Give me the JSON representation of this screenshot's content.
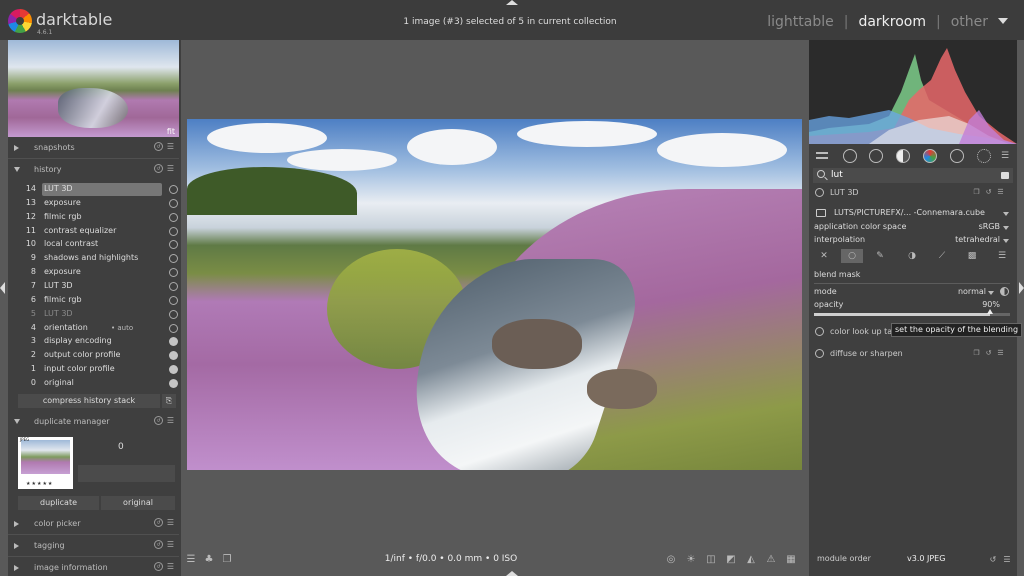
{
  "topbar": {
    "app_name": "darktable",
    "version": "4.6.1",
    "status": "1 image (#3) selected of 5 in current collection",
    "views": {
      "lighttable": "lighttable",
      "darkroom": "darkroom",
      "other": "other"
    }
  },
  "left_panel": {
    "navigation": {
      "zoom_label": "fit"
    },
    "snapshots": {
      "label": "snapshots"
    },
    "history": {
      "label": "history",
      "items": [
        {
          "num": "14",
          "name": "LUT 3D"
        },
        {
          "num": "13",
          "name": "exposure"
        },
        {
          "num": "12",
          "name": "filmic rgb"
        },
        {
          "num": "11",
          "name": "contrast equalizer"
        },
        {
          "num": "10",
          "name": "local contrast"
        },
        {
          "num": "9",
          "name": "shadows and highlights"
        },
        {
          "num": "8",
          "name": "exposure"
        },
        {
          "num": "7",
          "name": "LUT 3D"
        },
        {
          "num": "6",
          "name": "filmic rgb"
        },
        {
          "num": "5",
          "name": "LUT 3D"
        },
        {
          "num": "4",
          "name": "orientation",
          "suffix": "• auto"
        },
        {
          "num": "3",
          "name": "display encoding"
        },
        {
          "num": "2",
          "name": "output color profile"
        },
        {
          "num": "1",
          "name": "input color profile"
        },
        {
          "num": "0",
          "name": "original"
        }
      ],
      "compress_label": "compress history stack"
    },
    "duplicate_manager": {
      "label": "duplicate manager",
      "version_number": "0",
      "thumb_tag": "JPEG",
      "thumb_stars": "★★★★★",
      "duplicate_label": "duplicate",
      "original_label": "original"
    },
    "color_picker": {
      "label": "color picker"
    },
    "tagging": {
      "label": "tagging"
    },
    "image_information": {
      "label": "image information"
    }
  },
  "bottombar": {
    "info": "1/inf • f/0.0 • 0.0 mm • 0 ISO"
  },
  "right_panel": {
    "search": {
      "value": "lut"
    },
    "lut3d": {
      "label": "LUT 3D",
      "file": "LUTS/PICTUREFX/... -Connemara.cube",
      "params": [
        {
          "key": "application color space",
          "value": "sRGB"
        },
        {
          "key": "interpolation",
          "value": "tetrahedral"
        }
      ],
      "blend_label": "blend mask",
      "mode_key": "mode",
      "mode_value": "normal",
      "opacity_key": "opacity",
      "opacity_value": "90%",
      "opacity_fraction": 0.9
    },
    "color_lookup_table": {
      "label": "color look up table"
    },
    "diffuse": {
      "label": "diffuse or sharpen"
    },
    "tooltip": "set the opacity of the blending",
    "module_order": {
      "label": "module order",
      "value": "v3.0 JPEG"
    }
  },
  "icons": {
    "search": "search-icon",
    "power": "power-icon",
    "reset": "reset-icon",
    "presets": "presets-icon",
    "folder": "folder-icon"
  }
}
